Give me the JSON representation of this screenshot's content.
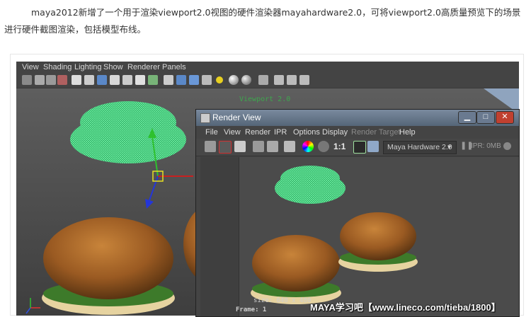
{
  "article": {
    "intro": "maya2012新增了一个用于渲染viewport2.0视图的硬件渲染器mayahardware2.0，可将viewport2.0高质量预览下的场景进行硬件截图渲染，包括模型布线。"
  },
  "maya": {
    "menu": [
      "View",
      "Shading",
      "Lighting",
      "Show",
      "Renderer",
      "Panels"
    ],
    "viewport_label": "Viewport 2.0"
  },
  "render_view": {
    "title": "Render View",
    "menu": [
      "File",
      "View",
      "Render",
      "IPR",
      "Options",
      "Display",
      "Render Target",
      "Help"
    ],
    "ratio_label": "1:1",
    "renderer": "Maya Hardware 2.0",
    "ipr_label": "IPR: 0MB",
    "size_text": "size: 640 x 480",
    "frame_text": "Frame: 1"
  },
  "watermark": "MAYA学习吧【www.lineco.com/tieba/1800】"
}
